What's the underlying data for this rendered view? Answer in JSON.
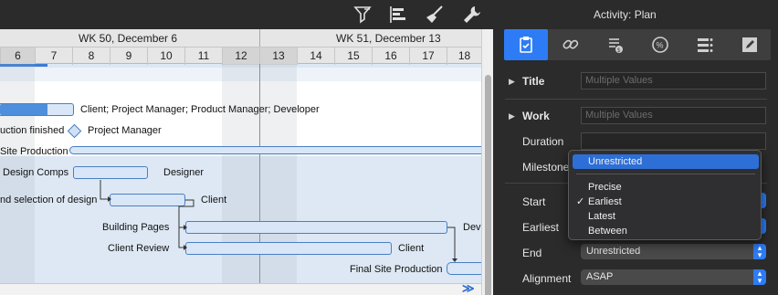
{
  "toolbar": {
    "icons": [
      "filter-icon",
      "align-icon",
      "broom-icon",
      "wrench-icon"
    ]
  },
  "timeline": {
    "weeks": [
      {
        "label": "WK 50, December 6"
      },
      {
        "label": "WK 51, December 13"
      }
    ],
    "days": [
      "6",
      "7",
      "8",
      "9",
      "10",
      "11",
      "12",
      "13",
      "14",
      "15",
      "16",
      "17",
      "18"
    ]
  },
  "gantt": {
    "resources": {
      "build_site": "Client; Project Manager; Product Manager; Developer",
      "production_finished": "Project Manager",
      "design_comps": "Designer",
      "selection": "Client",
      "building_pages": "Dev",
      "client_review": "Client"
    },
    "tasks": {
      "production_finished": "uction finished",
      "site_production": "Site Production",
      "design_comps": "Design Comps",
      "selection": "nd selection of design",
      "building_pages": "Building Pages",
      "client_review": "Client Review",
      "final_site_production": "Final Site Production"
    },
    "more": "≫"
  },
  "inspector": {
    "activity_prefix": "Activity:",
    "activity_name": "Plan",
    "tabs": [
      "clipboard-icon",
      "link-icon",
      "cost-icon",
      "percent-icon",
      "list-icon",
      "pencil-icon"
    ],
    "title_label": "Title",
    "title_placeholder": "Multiple Values",
    "work_label": "Work",
    "work_placeholder": "Multiple Values",
    "duration_label": "Duration",
    "milestone_label": "Milestone",
    "start_label": "Start",
    "earliest_label": "Earliest",
    "end_label": "End",
    "end_value": "Unrestricted",
    "alignment_label": "Alignment",
    "alignment_value": "ASAP",
    "accent_color": "#2d7cf6"
  },
  "dropdown": {
    "items": [
      "Unrestricted",
      "Precise",
      "Earliest",
      "Latest",
      "Between"
    ],
    "highlighted": "Unrestricted",
    "checked": "Earliest",
    "check_mark": "✓"
  }
}
